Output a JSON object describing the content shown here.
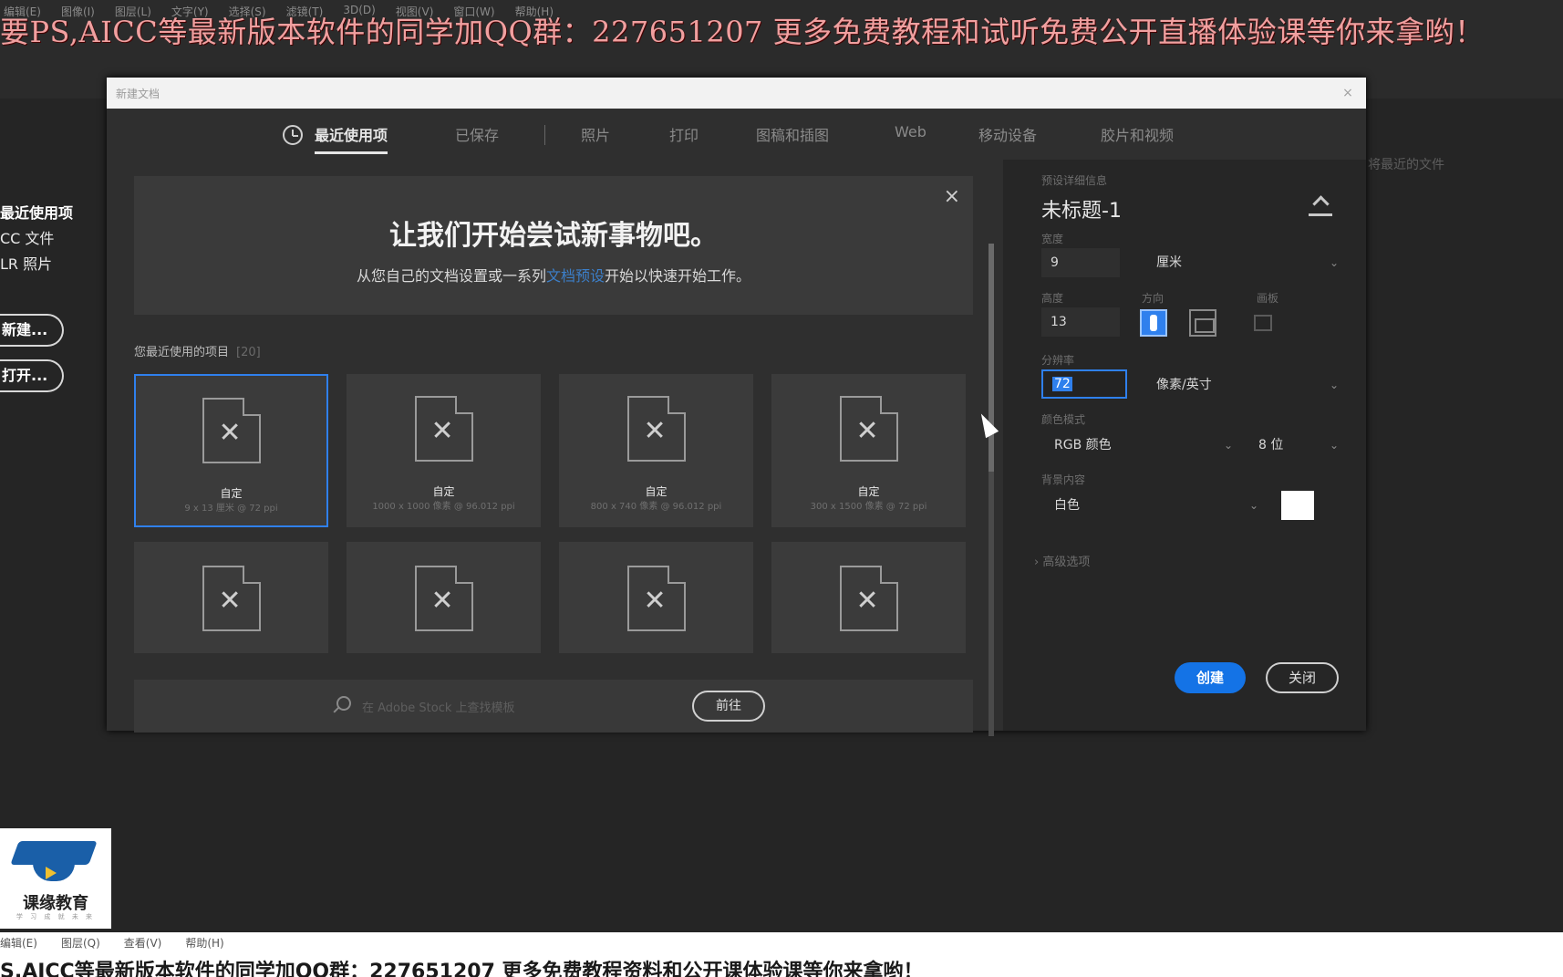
{
  "top": {
    "menu": [
      "编辑(E)",
      "图像(I)",
      "图层(L)",
      "文字(Y)",
      "选择(S)",
      "滤镜(T)",
      "3D(D)",
      "视图(V)",
      "窗口(W)",
      "帮助(H)"
    ],
    "ad": "要PS,AICC等最新版本软件的同学加QQ群：227651207 更多免费教程和试听免费公开直播体验课等你来拿哟！"
  },
  "left_panel": {
    "items": [
      "最近使用项",
      "CC 文件",
      "LR 照片"
    ],
    "new_button": "新建...",
    "open_button": "打开..."
  },
  "right_hint": "将最近的文件",
  "dialog": {
    "title": "新建文档",
    "close_glyph": "×",
    "tabs": [
      {
        "label": "最近使用项",
        "active": true
      },
      {
        "label": "已保存"
      },
      {
        "label": "照片"
      },
      {
        "label": "打印"
      },
      {
        "label": "图稿和插图"
      },
      {
        "label": "Web"
      },
      {
        "label": "移动设备"
      },
      {
        "label": "胶片和视频"
      }
    ],
    "welcome": {
      "heading": "让我们开始尝试新事物吧。",
      "sub_before": "从您自己的文档设置或一系列",
      "sub_link": "文档预设",
      "sub_after": "开始以快速开始工作。"
    },
    "recent": {
      "header": "您最近使用的项目",
      "count": "[20]",
      "cards": [
        {
          "name": "自定",
          "meta": "9 x 13 厘米 @ 72 ppi",
          "selected": true
        },
        {
          "name": "自定",
          "meta": "1000 x 1000 像素 @ 96.012 ppi"
        },
        {
          "name": "自定",
          "meta": "800 x 740 像素 @ 96.012 ppi"
        },
        {
          "name": "自定",
          "meta": "300 x 1500 像素 @ 72 ppi"
        },
        {
          "name": "",
          "meta": ""
        },
        {
          "name": "",
          "meta": ""
        },
        {
          "name": "",
          "meta": ""
        },
        {
          "name": "",
          "meta": ""
        }
      ]
    },
    "search": {
      "placeholder": "在 Adobe Stock 上查找模板",
      "go_button": "前往"
    },
    "details": {
      "section_label": "预设详细信息",
      "doc_title": "未标题-1",
      "width_label": "宽度",
      "width_value": "9",
      "unit": "厘米",
      "height_label": "高度",
      "height_value": "13",
      "orientation_label": "方向",
      "artboard_label": "画板",
      "resolution_label": "分辨率",
      "resolution_value": "72",
      "resolution_unit": "像素/英寸",
      "color_mode_label": "颜色模式",
      "color_mode": "RGB 颜色",
      "bit_depth": "8 位",
      "background_label": "背景内容",
      "background": "白色",
      "background_color": "#ffffff",
      "advanced": "高级选项",
      "create_button": "创建",
      "close_button": "关闭",
      "accent": "#1473e6"
    }
  },
  "logo": {
    "name": "课缘教育",
    "sub": "学 习 成 就 未 来"
  },
  "bottom": {
    "menu": [
      "编辑(E)",
      "图层(Q)",
      "查看(V)",
      "帮助(H)"
    ],
    "ad": "S,AICC等最新版本软件的同学加QQ群：227651207 更多免费教程资料和公开课体验课等你来拿哟！"
  }
}
